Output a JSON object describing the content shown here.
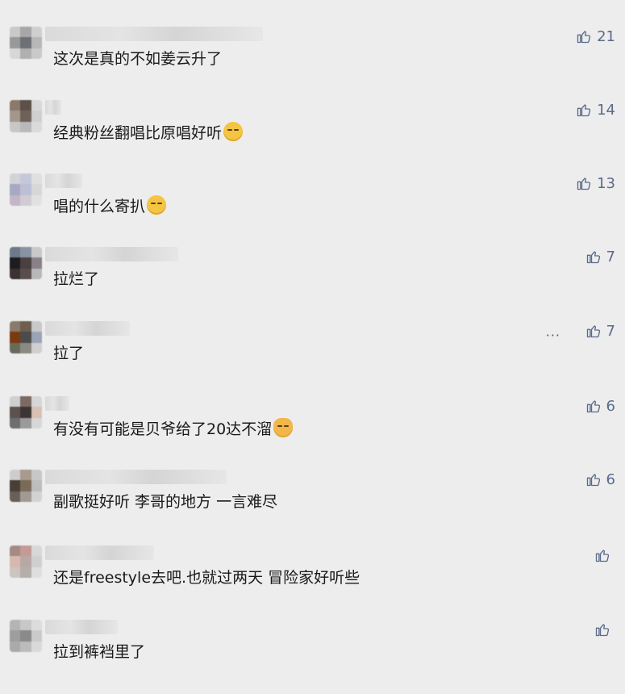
{
  "colors": {
    "background": "#ededed",
    "like": "#5a6b8a",
    "text": "#191919"
  },
  "comments": [
    {
      "text": "这次是真的不如姜云升了",
      "likes": "21",
      "emoji": null
    },
    {
      "text": "经典粉丝翻唱比原唱好听",
      "likes": "14",
      "emoji": "relieved-face"
    },
    {
      "text": "唱的什么寄扒",
      "likes": "13",
      "emoji": "grinning-sweat-face"
    },
    {
      "text": "拉烂了",
      "likes": "7",
      "emoji": null
    },
    {
      "text": "拉了",
      "likes": "7",
      "emoji": null,
      "more_label": "···"
    },
    {
      "text": "有没有可能是贝爷给了20达不溜",
      "likes": "6",
      "emoji": "cat-face"
    },
    {
      "text": "副歌挺好听 李哥的地方 一言难尽",
      "likes": "6",
      "emoji": null
    },
    {
      "text": "还是freestyle去吧.也就过两天 冒险家好听些",
      "likes": "",
      "emoji": null
    },
    {
      "text": "拉到裤裆里了",
      "likes": "",
      "emoji": null
    }
  ]
}
